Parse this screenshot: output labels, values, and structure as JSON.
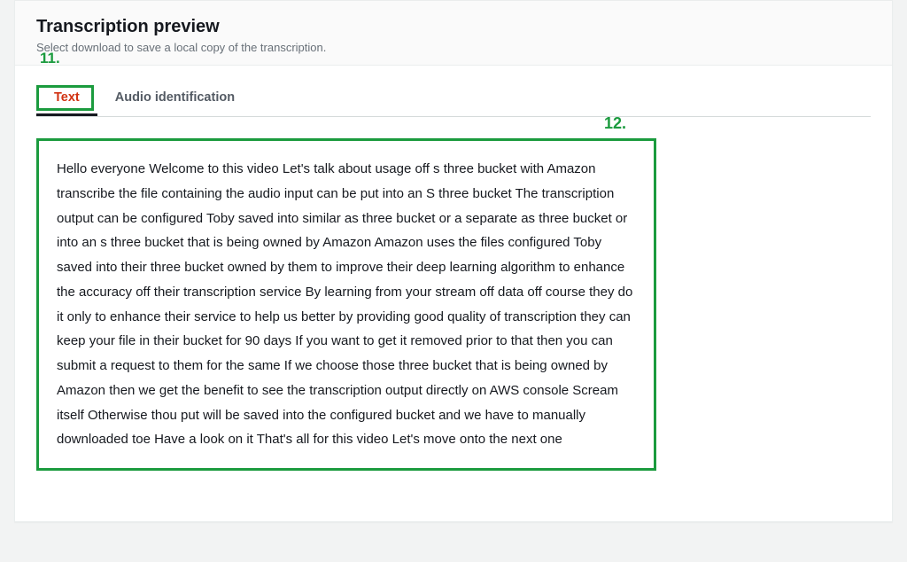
{
  "header": {
    "title": "Transcription preview",
    "subtitle": "Select download to save a local copy of the transcription."
  },
  "tabs": {
    "text_label": "Text",
    "audio_label": "Audio identification"
  },
  "annotations": {
    "label11": "11.",
    "label12": "12."
  },
  "transcription": {
    "body": "Hello everyone Welcome to this video Let's talk about usage off s three bucket with Amazon transcribe the file containing the audio input can be put into an S three bucket The transcription output can be configured Toby saved into similar as three bucket or a separate as three bucket or into an s three bucket that is being owned by Amazon Amazon uses the files configured Toby saved into their three bucket owned by them to improve their deep learning algorithm to enhance the accuracy off their transcription service By learning from your stream off data off course they do it only to enhance their service to help us better by providing good quality of transcription they can keep your file in their bucket for 90 days If you want to get it removed prior to that then you can submit a request to them for the same If we choose those three bucket that is being owned by Amazon then we get the benefit to see the transcription output directly on AWS console Scream itself Otherwise thou put will be saved into the configured bucket and we have to manually downloaded toe Have a look on it That's all for this video Let's move onto the next one"
  }
}
